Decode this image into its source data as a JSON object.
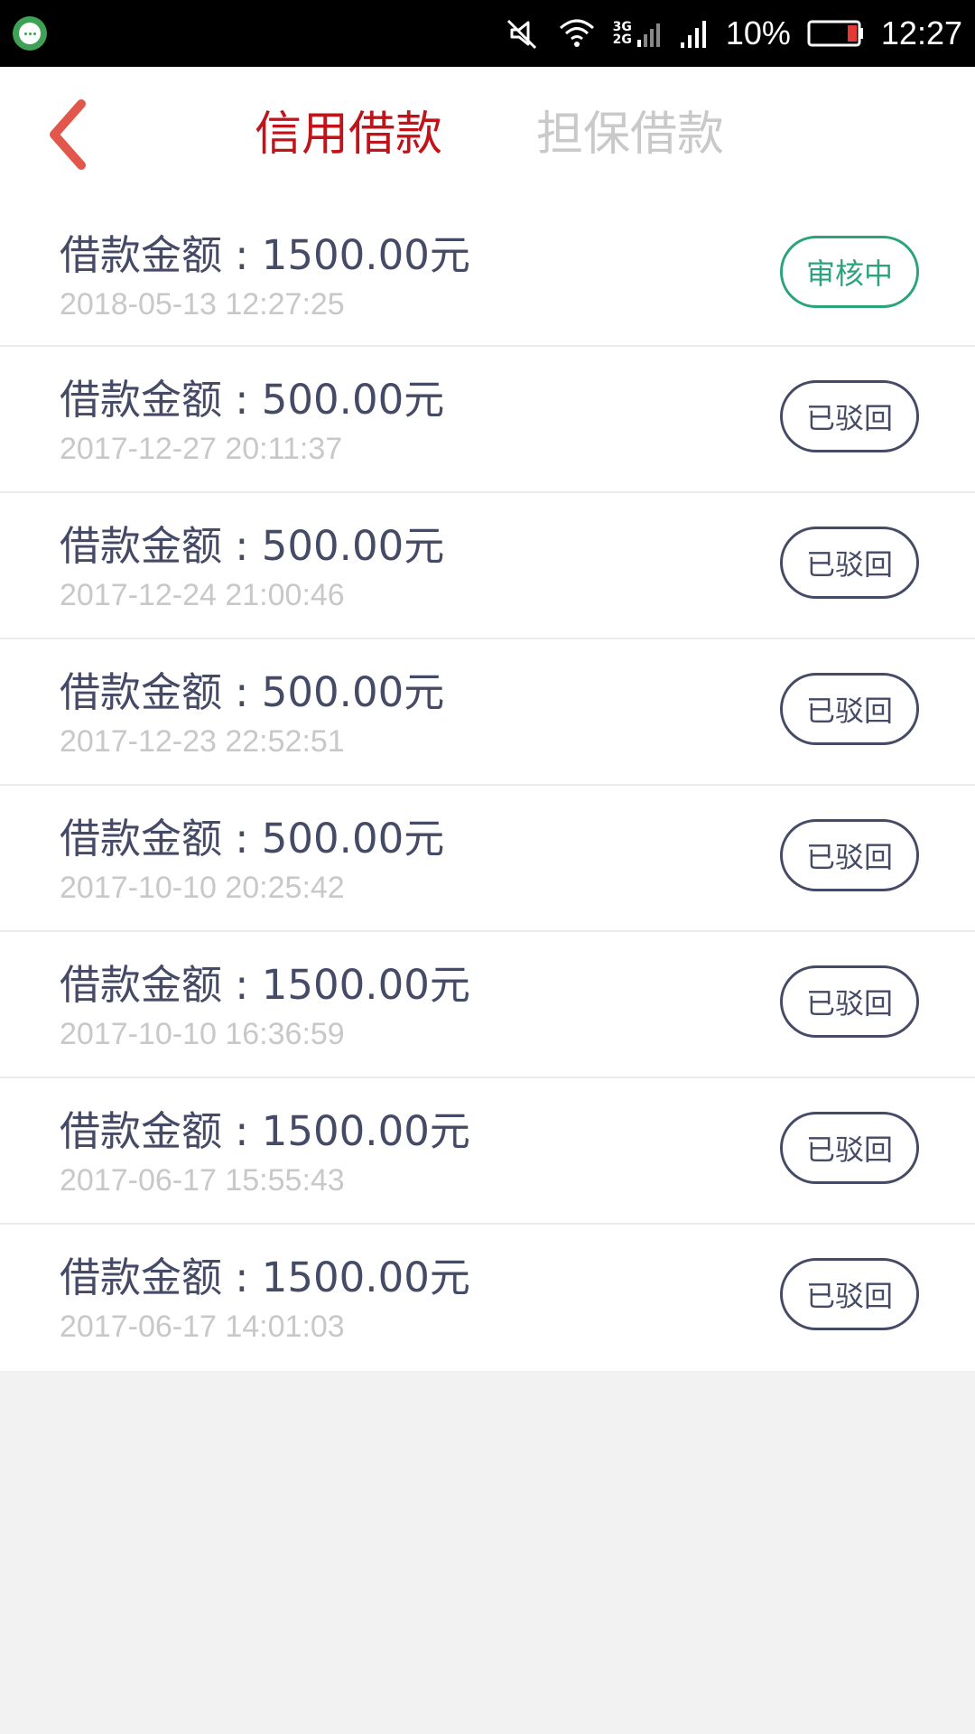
{
  "status_bar": {
    "battery": "10%",
    "time": "12:27",
    "network_top": "3G",
    "network_bottom": "2G",
    "icons": [
      "app-chat-icon",
      "mute-icon",
      "wifi-icon",
      "mobile-signal-icon",
      "cell-signal-icon",
      "battery-icon"
    ]
  },
  "header": {
    "tabs": [
      {
        "label": "信用借款",
        "active": true
      },
      {
        "label": "担保借款",
        "active": false
      }
    ]
  },
  "loans": [
    {
      "amount": "借款金额 : 1500.00元",
      "date": "2018-05-13 12:27:25",
      "status": "审核中",
      "state": "pending"
    },
    {
      "amount": "借款金额 : 500.00元",
      "date": "2017-12-27 20:11:37",
      "status": "已驳回",
      "state": "rejected"
    },
    {
      "amount": "借款金额 : 500.00元",
      "date": "2017-12-24 21:00:46",
      "status": "已驳回",
      "state": "rejected"
    },
    {
      "amount": "借款金额 : 500.00元",
      "date": "2017-12-23 22:52:51",
      "status": "已驳回",
      "state": "rejected"
    },
    {
      "amount": "借款金额 : 500.00元",
      "date": "2017-10-10 20:25:42",
      "status": "已驳回",
      "state": "rejected"
    },
    {
      "amount": "借款金额 : 1500.00元",
      "date": "2017-10-10 16:36:59",
      "status": "已驳回",
      "state": "rejected"
    },
    {
      "amount": "借款金额 : 1500.00元",
      "date": "2017-06-17 15:55:43",
      "status": "已驳回",
      "state": "rejected"
    },
    {
      "amount": "借款金额 : 1500.00元",
      "date": "2017-06-17 14:01:03",
      "status": "已驳回",
      "state": "rejected"
    }
  ],
  "colors": {
    "active_tab": "#c0141a",
    "inactive_tab": "#c9c9c9",
    "pending": "#2ba37c",
    "rejected": "#454a66",
    "back_arrow": "#e2574c"
  }
}
